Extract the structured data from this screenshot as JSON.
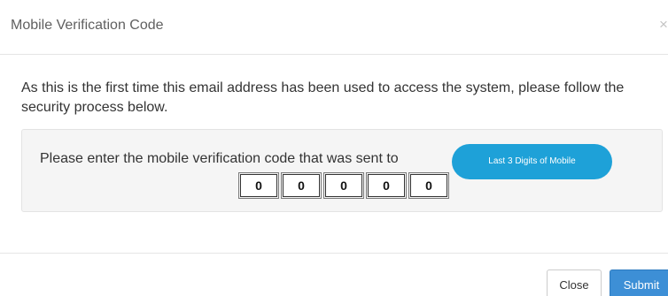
{
  "modal": {
    "title": "Mobile Verification Code",
    "close_glyph": "×",
    "intro": "As this is the first time this email address has been used to access the system, please follow the security process below.",
    "instruction": "Please enter the mobile verification code that was sent to",
    "mobile_badge": "Last 3 Digits of Mobile",
    "code_digits": [
      "0",
      "0",
      "0",
      "0",
      "0"
    ],
    "footer": {
      "close_label": "Close",
      "submit_label": "Submit"
    }
  },
  "colors": {
    "badge": "#1ea1d8",
    "submit_button": "#3d8fd6",
    "well_background": "#f5f5f5"
  },
  "icons": {
    "close": "close-icon"
  }
}
